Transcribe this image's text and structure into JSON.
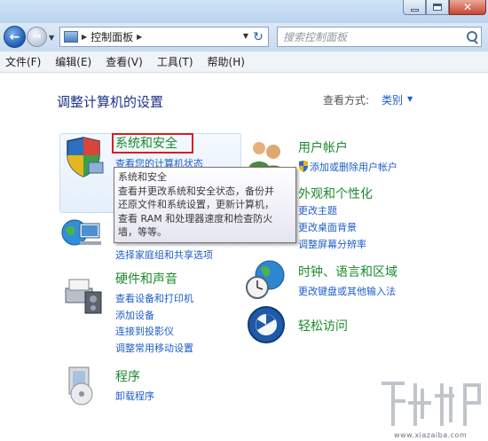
{
  "toolbar": {
    "breadcrumb": "控制面板",
    "search_placeholder": "搜索控制面板"
  },
  "menu": [
    "文件(F)",
    "编辑(E)",
    "查看(V)",
    "工具(T)",
    "帮助(H)"
  ],
  "content": {
    "heading": "调整计算机的设置",
    "view_by_label": "查看方式:",
    "view_by_value": "类别",
    "categories": [
      {
        "title": "系统和安全",
        "links": [
          "查看您的计算机状态"
        ]
      },
      {
        "title": "",
        "links": [
          "选择家庭组和共享选项"
        ]
      },
      {
        "title": "硬件和声音",
        "links": [
          "查看设备和打印机",
          "添加设备",
          "连接到投影仪",
          "调整常用移动设置"
        ]
      },
      {
        "title": "程序",
        "links": [
          "卸载程序"
        ]
      },
      {
        "title": "用户帐户",
        "links": [
          "添加或删除用户帐户"
        ]
      },
      {
        "title": "外观和个性化",
        "links": [
          "更改主题",
          "更改桌面背景",
          "调整屏幕分辨率"
        ]
      },
      {
        "title": "时钟、语言和区域",
        "links": [
          "更改键盘或其他输入法"
        ]
      },
      {
        "title": "轻松访问",
        "links": []
      }
    ],
    "tooltip_lines": [
      "系统和安全",
      "查看并更改系统和安全状态，备份并",
      "还原文件和系统设置，更新计算机，",
      "查看 RAM 和处理器速度和检查防火",
      "墙，等等。"
    ]
  },
  "watermark": {
    "text": "www.xiazaiba.com"
  },
  "colors": {
    "accent": "#1e5ec8",
    "category_title": "#1b8a2c",
    "heading": "#1e3287",
    "highlight": "#d81f1f"
  }
}
